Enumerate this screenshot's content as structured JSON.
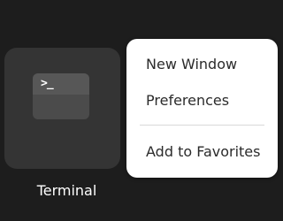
{
  "app_grid": {
    "tiles": [
      {
        "label": "Terminal",
        "icon": "terminal-icon",
        "icon_glyph": ">_"
      }
    ]
  },
  "context_menu": {
    "items": [
      {
        "label": "New Window"
      },
      {
        "label": "Preferences"
      },
      {
        "label": "Add to Favorites"
      }
    ]
  },
  "colors": {
    "background": "#1d1d1d",
    "tile": "#343434",
    "menu": "#ffffff",
    "menu_text": "#2b2b2b",
    "separator": "#d8d8d8"
  }
}
